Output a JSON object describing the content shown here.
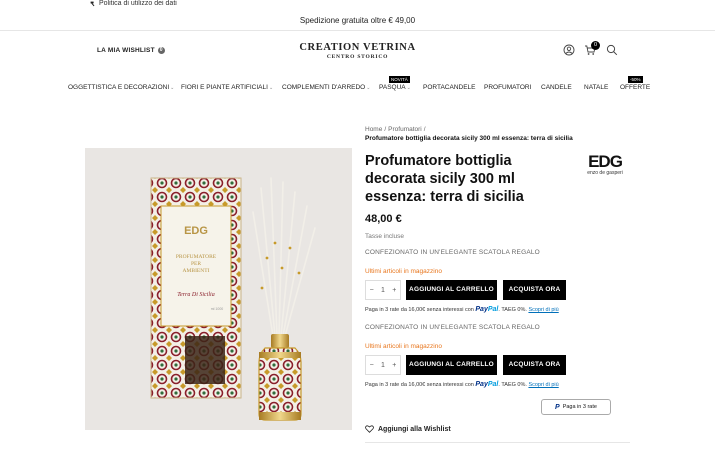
{
  "topbar": {
    "policy_link": "Politica di utilizzo dei dati"
  },
  "shipping_banner": "Spedizione gratuita oltre € 49,00",
  "header": {
    "wishlist_label": "LA MIA WISHLIST",
    "wishlist_count": "0",
    "logo_line1": "CREATION VETRINA",
    "logo_line2": "CENTRO STORICO",
    "cart_count": "0"
  },
  "nav": {
    "items": [
      {
        "label": "OGGETTISTICA E DECORAZIONI",
        "has_dropdown": true
      },
      {
        "label": "FIORI E PIANTE ARTIFICIALI",
        "has_dropdown": true
      },
      {
        "label": "COMPLEMENTI D'ARREDO",
        "has_dropdown": true
      },
      {
        "label": "PASQUA",
        "has_dropdown": true,
        "badge": "NOVITÀ"
      },
      {
        "label": "PORTACANDELE",
        "has_dropdown": false
      },
      {
        "label": "PROFUMATORI",
        "has_dropdown": false
      },
      {
        "label": "CANDELE",
        "has_dropdown": false
      },
      {
        "label": "NATALE",
        "has_dropdown": false
      },
      {
        "label": "OFFERTE",
        "has_dropdown": false,
        "badge": "-50%"
      }
    ]
  },
  "product_image": {
    "box_top": "EDG",
    "box_title_1": "PROFUMATORE",
    "box_title_2": "PER",
    "box_title_3": "AMBIENTI",
    "box_scent": "Terra Di Sicilia",
    "box_volume": "ml 1000"
  },
  "breadcrumb": {
    "items": [
      "Home",
      "Profumatori"
    ],
    "current": "Profumatore bottiglia decorata sicily 300 ml essenza: terra di sicilia"
  },
  "product": {
    "title": "Profumatore bottiglia decorata sicily 300 ml essenza: terra di sicilia",
    "price": "48,00 €",
    "tax_note": "Tasse incluse",
    "gift_note": "CONFEZIONATO IN UN'ELEGANTE SCATOLA REGALO",
    "stock_note": "Ultimi articoli in magazzino",
    "quantity": "1",
    "qty_minus": "−",
    "qty_plus": "+",
    "add_to_cart": "AGGIUNGI AL CARRELLO",
    "buy_now": "ACQUISTA ORA",
    "paypal_text": "Paga in 3 rate da 16,00€ senza interessi con",
    "paypal_brand_pay": "Pay",
    "paypal_brand_pal": "Pal",
    "paypal_taeg": ". TAEG 0%.",
    "paypal_more": "Scopri di più",
    "paypal_button": "Paga in 3 rate",
    "paypal_button_mark": "P",
    "add_wishlist": "Aggiungi alla Wishlist"
  },
  "brand": {
    "logo_big": "EDG",
    "logo_small": "enzo de gasperi"
  },
  "colors": {
    "accent": "#000000",
    "stock_warning": "#e8761d",
    "paypal_dark": "#003087",
    "paypal_light": "#009cde"
  }
}
